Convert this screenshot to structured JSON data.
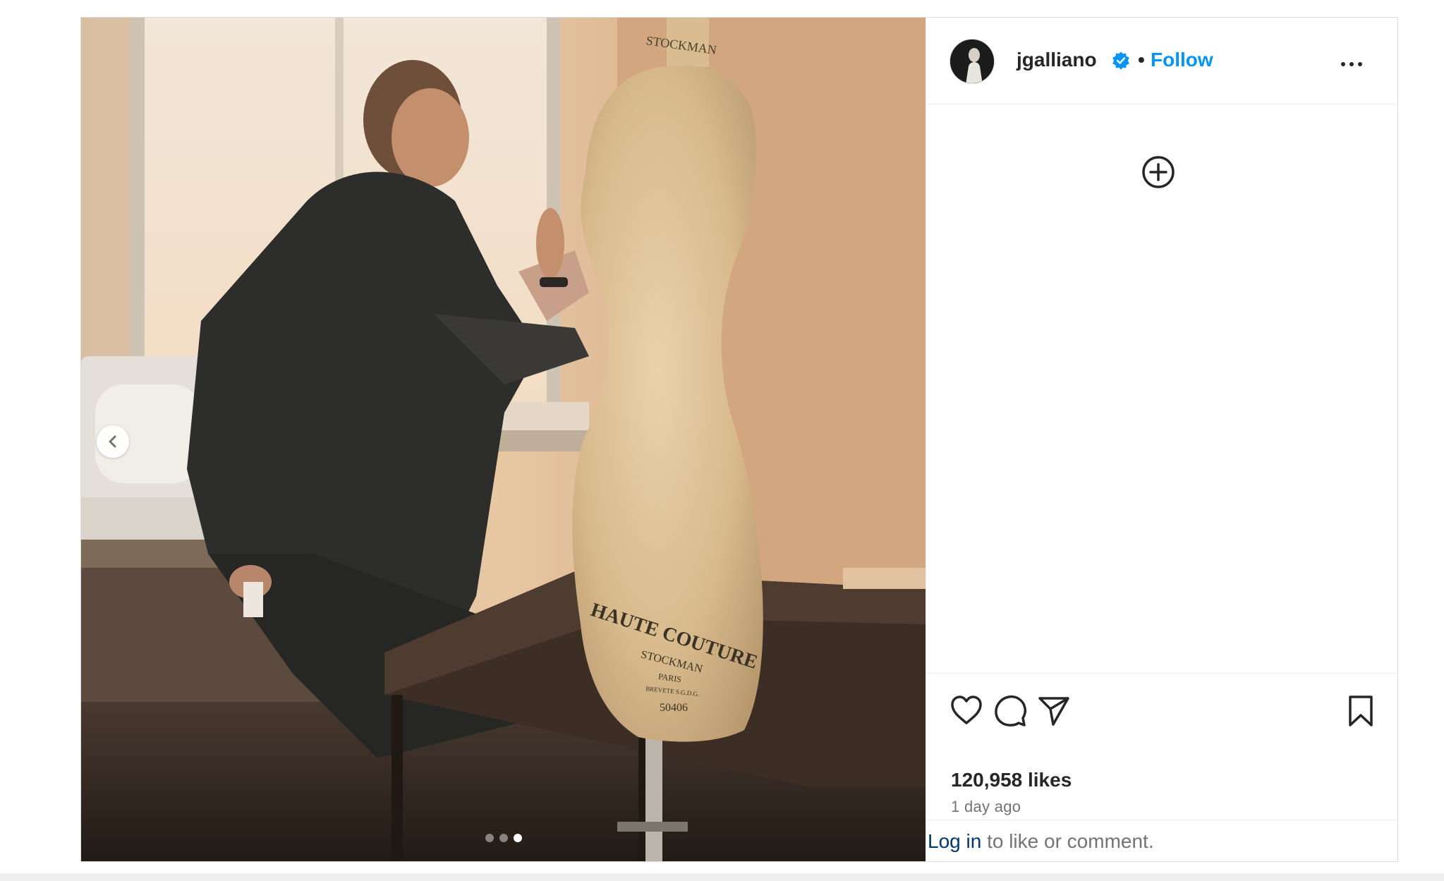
{
  "post": {
    "author": {
      "username": "jgalliano",
      "verified": true,
      "follow_label": "Follow",
      "separator": "•"
    },
    "media": {
      "dots_count": 3,
      "active_dot": 3,
      "mannequin_text": [
        "HAUTE COUTURE",
        "STOCKMAN",
        "PARIS",
        "BREVETE S.G.D.G.",
        "50406"
      ],
      "neck_text": "STOCKMAN"
    },
    "likes": "120,958 likes",
    "timestamp": "1 day ago",
    "login_prompt": {
      "link": "Log in",
      "rest": " to like or comment."
    }
  },
  "colors": {
    "accent": "#0095f6",
    "verified": "#0095f6",
    "text": "#262626",
    "muted": "#737373",
    "login_link": "#00376b"
  },
  "icons": {
    "prev": "chevron-left-icon",
    "more": "more-options-icon",
    "add": "add-circle-icon",
    "like": "heart-icon",
    "comment": "comment-icon",
    "share": "share-icon",
    "save": "bookmark-icon"
  }
}
